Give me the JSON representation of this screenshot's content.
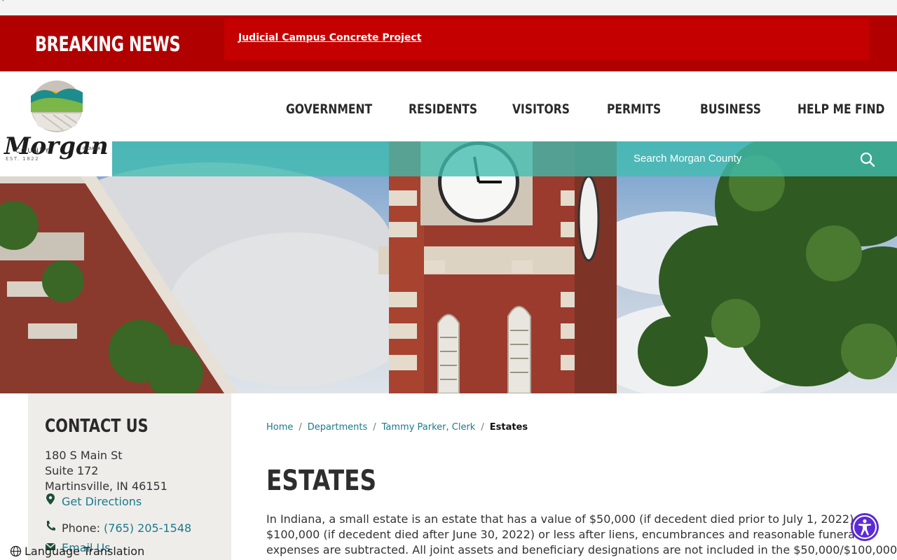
{
  "top_strip": {
    "mark": "`"
  },
  "breaking": {
    "label": "BREAKING NEWS",
    "headline": "Judicial Campus Concrete Project"
  },
  "logo": {
    "name": "Morgan",
    "county": "COUNTY",
    "state": "INDIANA",
    "est": "EST. 1822"
  },
  "nav": [
    {
      "label": "GOVERNMENT"
    },
    {
      "label": "RESIDENTS"
    },
    {
      "label": "VISITORS"
    },
    {
      "label": "PERMITS"
    },
    {
      "label": "BUSINESS"
    },
    {
      "label": "HELP ME FIND"
    }
  ],
  "search": {
    "placeholder": "Search Morgan County"
  },
  "contact": {
    "heading": "CONTACT US",
    "address1": "180 S Main St",
    "address2": "Suite 172",
    "address3": "Martinsville, IN 46151",
    "directions": "Get Directions",
    "phone_label": "Phone:",
    "phone": "(765) 205-1548",
    "email": "Email Us"
  },
  "language": {
    "label": "Language Translation"
  },
  "breadcrumb": {
    "home": "Home",
    "departments": "Departments",
    "clerk": "Tammy Parker, Clerk",
    "current": "Estates"
  },
  "page": {
    "title": "ESTATES",
    "line1": "In Indiana, a small estate is an estate that has a value of $50,000 (if decedent died prior to July 1, 2022),",
    "line2": "$100,000 (if decedent died after June 30, 2022) or less after liens, encumbrances and reasonable funeral",
    "line3": "expenses are subtracted.  All joint assets and beneficiary designations are not included in the $50,000/$100,000"
  },
  "colors": {
    "breaking_bg": "#b00000",
    "breaking_panel": "#c40000",
    "teal": "#40beaf",
    "link": "#1a7a8a",
    "accessibility": "#5b2bd6"
  },
  "icons": [
    "search-icon",
    "map-pin-icon",
    "phone-icon",
    "envelope-icon",
    "globe-icon",
    "accessibility-icon"
  ]
}
